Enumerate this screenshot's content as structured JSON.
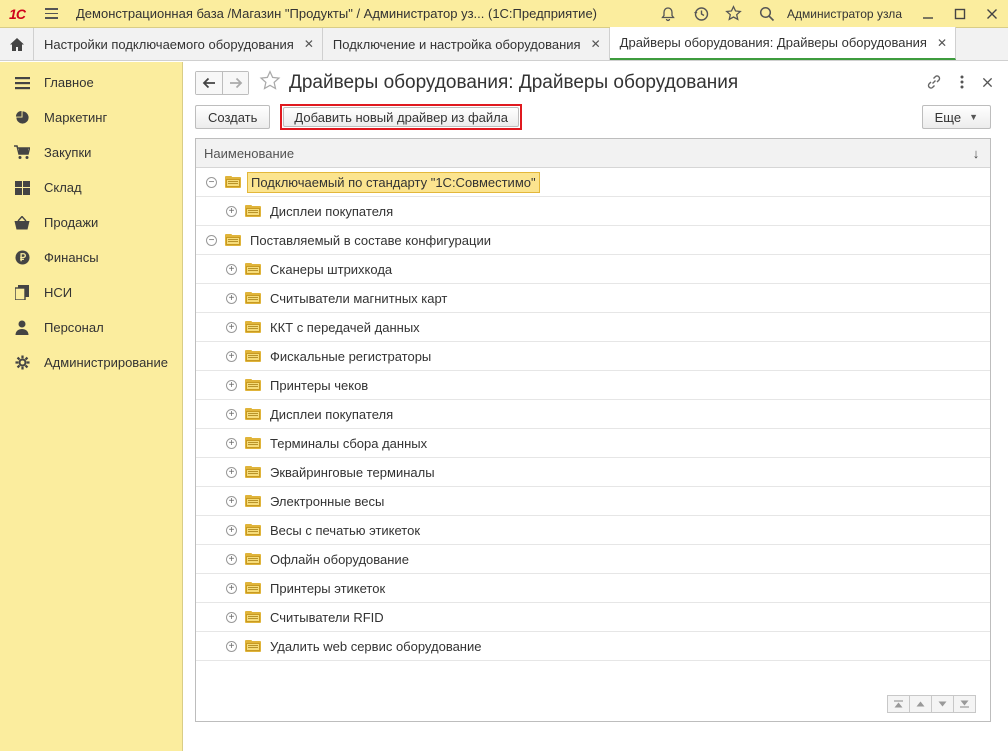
{
  "titlebar": {
    "logo": "1С",
    "title": "Демонстрационная база /Магазин \"Продукты\" / Администратор уз...  (1С:Предприятие)",
    "user": "Администратор узла"
  },
  "tabs": [
    {
      "label": "Настройки подключаемого оборудования",
      "close": "✕"
    },
    {
      "label": "Подключение и настройка оборудования",
      "close": "✕"
    },
    {
      "label": "Драйверы оборудования: Драйверы оборудования",
      "close": "✕"
    }
  ],
  "sidebar": {
    "items": [
      {
        "label": "Главное",
        "icon": "list-icon"
      },
      {
        "label": "Маркетинг",
        "icon": "pie-chart-icon"
      },
      {
        "label": "Закупки",
        "icon": "cart-icon"
      },
      {
        "label": "Склад",
        "icon": "warehouse-icon"
      },
      {
        "label": "Продажи",
        "icon": "basket-icon"
      },
      {
        "label": "Финансы",
        "icon": "ruble-icon"
      },
      {
        "label": "НСИ",
        "icon": "documents-icon"
      },
      {
        "label": "Персонал",
        "icon": "person-icon"
      },
      {
        "label": "Администрирование",
        "icon": "gear-icon"
      }
    ]
  },
  "page": {
    "title": "Драйверы оборудования: Драйверы оборудования"
  },
  "toolbar": {
    "create_label": "Создать",
    "add_driver_label": "Добавить новый драйвер из файла",
    "more_label": "Еще"
  },
  "grid": {
    "column": "Наименование",
    "sort_indicator": "↓",
    "rows": [
      {
        "label": "Подключаемый по стандарту \"1С:Совместимо\"",
        "level": 1,
        "expander": "⊖",
        "selected": true
      },
      {
        "label": "Дисплеи покупателя",
        "level": 2,
        "expander": "⊕"
      },
      {
        "label": "Поставляемый в составе конфигурации",
        "level": 1,
        "expander": "⊖"
      },
      {
        "label": "Сканеры штрихкода",
        "level": 2,
        "expander": "⊕"
      },
      {
        "label": "Считыватели магнитных карт",
        "level": 2,
        "expander": "⊕"
      },
      {
        "label": "ККТ с передачей данных",
        "level": 2,
        "expander": "⊕"
      },
      {
        "label": "Фискальные регистраторы",
        "level": 2,
        "expander": "⊕"
      },
      {
        "label": "Принтеры чеков",
        "level": 2,
        "expander": "⊕"
      },
      {
        "label": "Дисплеи покупателя",
        "level": 2,
        "expander": "⊕"
      },
      {
        "label": "Терминалы сбора данных",
        "level": 2,
        "expander": "⊕"
      },
      {
        "label": "Эквайринговые терминалы",
        "level": 2,
        "expander": "⊕"
      },
      {
        "label": "Электронные весы",
        "level": 2,
        "expander": "⊕"
      },
      {
        "label": "Весы с печатью этикеток",
        "level": 2,
        "expander": "⊕"
      },
      {
        "label": "Офлайн оборудование",
        "level": 2,
        "expander": "⊕"
      },
      {
        "label": "Принтеры этикеток",
        "level": 2,
        "expander": "⊕"
      },
      {
        "label": "Считыватели RFID",
        "level": 2,
        "expander": "⊕"
      },
      {
        "label": "Удалить web сервис оборудование",
        "level": 2,
        "expander": "⊕"
      }
    ]
  },
  "colors": {
    "sidebar_bg": "#fbed9e",
    "highlight_border": "#e0191f",
    "active_tab_underline": "#3d9c3d",
    "selected_row_bg": "#fbe48f"
  }
}
